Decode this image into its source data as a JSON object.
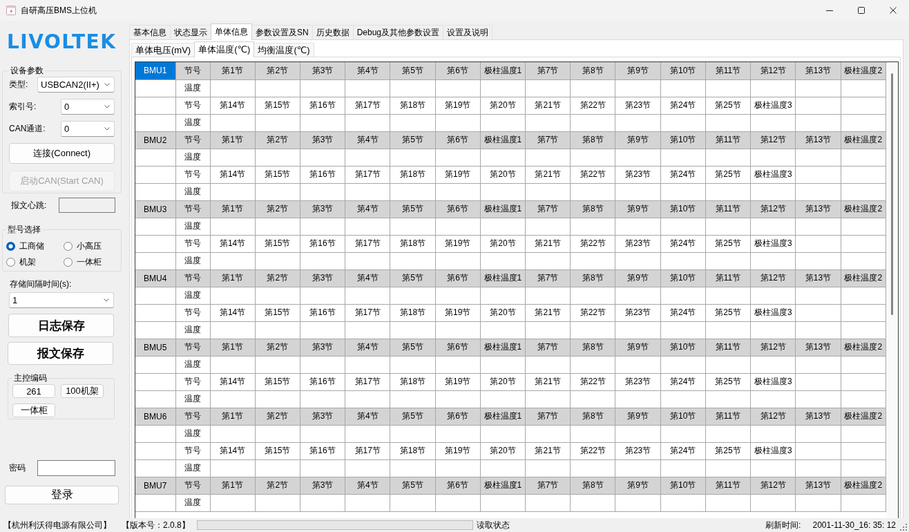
{
  "window": {
    "title": "自研高压BMS上位机"
  },
  "sidebar": {
    "logo": "LIVOLTEK",
    "device_params": {
      "title": "设备参数",
      "dropdowns": [
        {
          "label": "类型:",
          "value": "USBCAN2(II+)"
        },
        {
          "label": "索引号:",
          "value": "0"
        },
        {
          "label": "CAN通道:",
          "value": "0"
        }
      ],
      "buttons": [
        {
          "label": "连接(Connect)",
          "disabled": false
        },
        {
          "label": "启动CAN(Start CAN)",
          "disabled": true
        }
      ]
    },
    "heartbeat": {
      "label": "报文心跳:"
    },
    "model_select": {
      "title": "型号选择",
      "options": [
        {
          "label": "工商储",
          "selected": true
        },
        {
          "label": "小高压",
          "selected": false
        },
        {
          "label": "机架",
          "selected": false
        },
        {
          "label": "一体柜",
          "selected": false
        }
      ]
    },
    "save_interval": {
      "label": "存储间隔时间(s):",
      "value": "1"
    },
    "save_buttons": [
      "日志保存",
      "报文保存"
    ],
    "master_code": {
      "title": "主控编码",
      "buttons": [
        "261",
        "100机架",
        "一体柜"
      ]
    },
    "password": {
      "label": "密码"
    },
    "login_button": "登录"
  },
  "tabs": [
    {
      "label": "基本信息",
      "selected": false
    },
    {
      "label": "状态显示",
      "selected": false
    },
    {
      "label": "单体信息",
      "selected": true
    },
    {
      "label": "参数设置及SN",
      "selected": false
    },
    {
      "label": "历史数据",
      "selected": false
    },
    {
      "label": "Debug及其他参数设置",
      "selected": false
    },
    {
      "label": "设置及说明",
      "selected": false
    }
  ],
  "subtabs": [
    {
      "label": "单体电压(mV)",
      "selected": false
    },
    {
      "label": "单体温度(℃)",
      "selected": true
    },
    {
      "label": "均衡温度(℃)",
      "selected": false
    }
  ],
  "table": {
    "blocks": [
      {
        "name": "BMU1",
        "selected": true,
        "rows": [
          {
            "kind": "head",
            "label": "节号",
            "cells": [
              "第1节",
              "第2节",
              "第3节",
              "第4节",
              "第5节",
              "第6节",
              "极柱温度1",
              "第7节",
              "第8节",
              "第9节",
              "第10节",
              "第11节",
              "第12节",
              "第13节",
              "极柱温度2"
            ]
          },
          {
            "kind": "body",
            "label": "温度"
          },
          {
            "kind": "body",
            "label": "节号",
            "cells": [
              "第14节",
              "第15节",
              "第16节",
              "第17节",
              "第18节",
              "第19节",
              "第20节",
              "第21节",
              "第22节",
              "第23节",
              "第24节",
              "第25节",
              "极柱温度3"
            ]
          },
          {
            "kind": "body",
            "label": "温度"
          }
        ]
      },
      {
        "name": "BMU2",
        "selected": false,
        "rows": [
          {
            "kind": "head",
            "label": "节号",
            "cells": [
              "第1节",
              "第2节",
              "第3节",
              "第4节",
              "第5节",
              "第6节",
              "极柱温度1",
              "第7节",
              "第8节",
              "第9节",
              "第10节",
              "第11节",
              "第12节",
              "第13节",
              "极柱温度2"
            ]
          },
          {
            "kind": "body",
            "label": "温度"
          },
          {
            "kind": "body",
            "label": "节号",
            "cells": [
              "第14节",
              "第15节",
              "第16节",
              "第17节",
              "第18节",
              "第19节",
              "第20节",
              "第21节",
              "第22节",
              "第23节",
              "第24节",
              "第25节",
              "极柱温度3"
            ]
          },
          {
            "kind": "body",
            "label": "温度"
          }
        ]
      },
      {
        "name": "BMU3",
        "selected": false,
        "rows": [
          {
            "kind": "head",
            "label": "节号",
            "cells": [
              "第1节",
              "第2节",
              "第3节",
              "第4节",
              "第5节",
              "第6节",
              "极柱温度1",
              "第7节",
              "第8节",
              "第9节",
              "第10节",
              "第11节",
              "第12节",
              "第13节",
              "极柱温度2"
            ]
          },
          {
            "kind": "body",
            "label": "温度"
          },
          {
            "kind": "body",
            "label": "节号",
            "cells": [
              "第14节",
              "第15节",
              "第16节",
              "第17节",
              "第18节",
              "第19节",
              "第20节",
              "第21节",
              "第22节",
              "第23节",
              "第24节",
              "第25节",
              "极柱温度3"
            ]
          },
          {
            "kind": "body",
            "label": "温度"
          }
        ]
      },
      {
        "name": "BMU4",
        "selected": false,
        "rows": [
          {
            "kind": "head",
            "label": "节号",
            "cells": [
              "第1节",
              "第2节",
              "第3节",
              "第4节",
              "第5节",
              "第6节",
              "极柱温度1",
              "第7节",
              "第8节",
              "第9节",
              "第10节",
              "第11节",
              "第12节",
              "第13节",
              "极柱温度2"
            ]
          },
          {
            "kind": "body",
            "label": "温度"
          },
          {
            "kind": "body",
            "label": "节号",
            "cells": [
              "第14节",
              "第15节",
              "第16节",
              "第17节",
              "第18节",
              "第19节",
              "第20节",
              "第21节",
              "第22节",
              "第23节",
              "第24节",
              "第25节",
              "极柱温度3"
            ]
          },
          {
            "kind": "body",
            "label": "温度"
          }
        ]
      },
      {
        "name": "BMU5",
        "selected": false,
        "rows": [
          {
            "kind": "head",
            "label": "节号",
            "cells": [
              "第1节",
              "第2节",
              "第3节",
              "第4节",
              "第5节",
              "第6节",
              "极柱温度1",
              "第7节",
              "第8节",
              "第9节",
              "第10节",
              "第11节",
              "第12节",
              "第13节",
              "极柱温度2"
            ]
          },
          {
            "kind": "body",
            "label": "温度"
          },
          {
            "kind": "body",
            "label": "节号",
            "cells": [
              "第14节",
              "第15节",
              "第16节",
              "第17节",
              "第18节",
              "第19节",
              "第20节",
              "第21节",
              "第22节",
              "第23节",
              "第24节",
              "第25节",
              "极柱温度3"
            ]
          },
          {
            "kind": "body",
            "label": "温度"
          }
        ]
      },
      {
        "name": "BMU6",
        "selected": false,
        "rows": [
          {
            "kind": "head",
            "label": "节号",
            "cells": [
              "第1节",
              "第2节",
              "第3节",
              "第4节",
              "第5节",
              "第6节",
              "极柱温度1",
              "第7节",
              "第8节",
              "第9节",
              "第10节",
              "第11节",
              "第12节",
              "第13节",
              "极柱温度2"
            ]
          },
          {
            "kind": "body",
            "label": "温度"
          },
          {
            "kind": "body",
            "label": "节号",
            "cells": [
              "第14节",
              "第15节",
              "第16节",
              "第17节",
              "第18节",
              "第19节",
              "第20节",
              "第21节",
              "第22节",
              "第23节",
              "第24节",
              "第25节",
              "极柱温度3"
            ]
          },
          {
            "kind": "body",
            "label": "温度"
          }
        ]
      },
      {
        "name": "BMU7",
        "selected": false,
        "rows": [
          {
            "kind": "head",
            "label": "节号",
            "cells": [
              "第1节",
              "第2节",
              "第3节",
              "第4节",
              "第5节",
              "第6节",
              "极柱温度1",
              "第7节",
              "第8节",
              "第9节",
              "第10节",
              "第11节",
              "第12节",
              "第13节",
              "极柱温度2"
            ]
          },
          {
            "kind": "body",
            "label": "温度"
          }
        ]
      }
    ]
  },
  "status_bar": {
    "company": "【杭州利沃得电源有限公司】",
    "version": "【版本号：2.0.8】",
    "progress": {
      "level": 0
    },
    "read_status": "读取状态",
    "refresh_label": "刷新时间:",
    "refresh_time": "2001-11-30_16: 35: 12"
  }
}
